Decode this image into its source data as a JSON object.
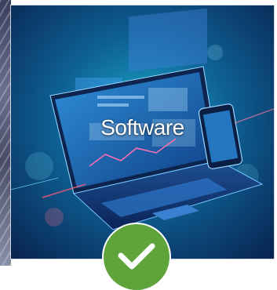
{
  "card": {
    "label": "Software",
    "selected": true,
    "check_icon": "checkmark-icon",
    "colors": {
      "badge": "#5fa43b",
      "tile_background": "#0b3a6b",
      "label": "#ffffff"
    }
  }
}
